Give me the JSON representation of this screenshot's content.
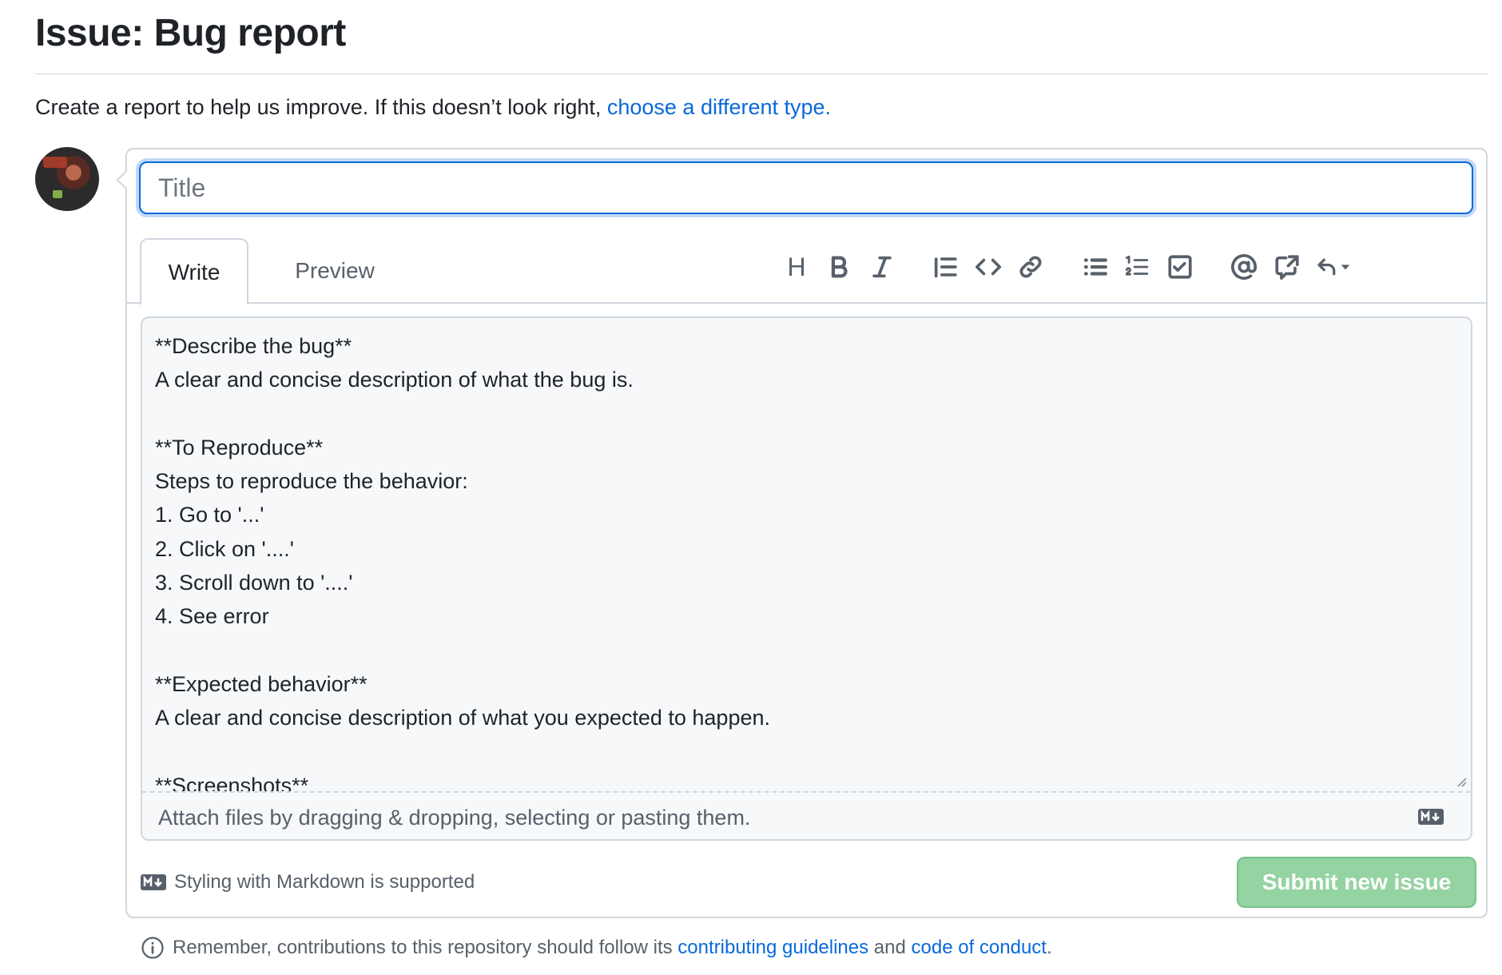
{
  "page": {
    "title": "Issue: Bug report",
    "subtitle": "Create a report to help us improve. If this doesn’t look right, ",
    "subtitle_link": "choose a different type."
  },
  "title_input": {
    "placeholder": "Title",
    "value": ""
  },
  "tabs": [
    {
      "label": "Write",
      "selected": true
    },
    {
      "label": "Preview",
      "selected": false
    }
  ],
  "toolbar": {
    "heading_label": "H",
    "icons": [
      "heading-icon",
      "bold-icon",
      "italic-icon",
      "quote-icon",
      "code-icon",
      "link-icon",
      "unordered-list-icon",
      "ordered-list-icon",
      "task-list-icon",
      "mention-icon",
      "cross-reference-icon",
      "reply-icon"
    ]
  },
  "editor": {
    "body": "**Describe the bug**\nA clear and concise description of what the bug is.\n\n**To Reproduce**\nSteps to reproduce the behavior:\n1. Go to '...'\n2. Click on '....'\n3. Scroll down to '....'\n4. See error\n\n**Expected behavior**\nA clear and concise description of what you expected to happen.\n\n**Screenshots**",
    "attach_hint": "Attach files by dragging & dropping, selecting or pasting them."
  },
  "markdown_note": "Styling with Markdown is supported",
  "submit_label": "Submit new issue",
  "footer": {
    "prefix": "Remember, contributions to this repository should follow its ",
    "guidelines_link": "contributing guidelines",
    "middle": " and ",
    "conduct_link": "code of conduct",
    "suffix": "."
  },
  "colors": {
    "link": "#0969da",
    "submit_disabled": "#94d3a2",
    "focus_border": "#0969da",
    "muted_text": "#57606a"
  }
}
